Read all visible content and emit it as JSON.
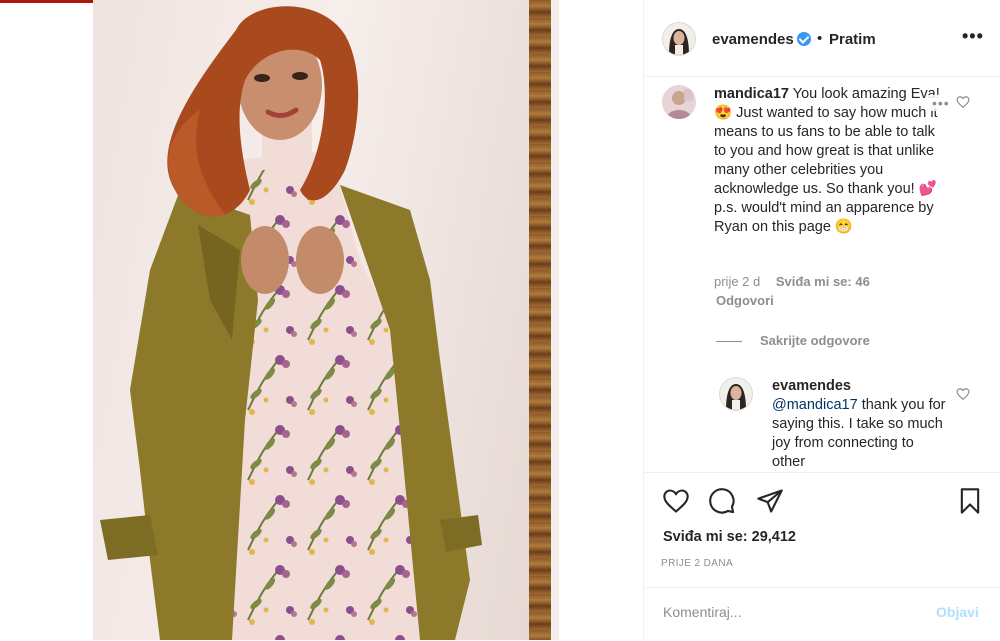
{
  "post": {
    "author": "evamendes",
    "follow_state": "Pratim",
    "more": "•••",
    "likes_text": "Sviđa mi se: 29,412",
    "time_text": "PRIJE 2 DANA"
  },
  "comment": {
    "username": "mandica17",
    "text": "You look amazing Eva! 😍 Just wanted to say how much it means to us fans to be able to talk to you and how great is that unlike many other celebrities you acknowledge us. So thank you! 💕 p.s. would't mind an apparence by Ryan on this page 😁",
    "more": "•••",
    "time": "prije 2 d",
    "likes": "Sviđa mi se: 46",
    "reply_label": "Odgovori",
    "hide_replies": "Sakrijte odgovore"
  },
  "reply": {
    "username": "evamendes",
    "mention": "@mandica17",
    "text": "thank you for saying this. I take so much joy from connecting to other"
  },
  "composer": {
    "placeholder": "Komentiraj...",
    "post_label": "Objavi"
  },
  "icons": {
    "like": "heart-icon",
    "comment": "comment-icon",
    "share": "share-icon",
    "save": "bookmark-icon",
    "verified": "verified-badge-icon",
    "more": "more-options-icon"
  },
  "colors": {
    "link_blue": "#003569",
    "verified_blue": "#3897f0",
    "post_disabled": "#b2dffc",
    "muted": "#8e8e8e",
    "coat": "#8c7a2a",
    "hair": "#a8491e"
  }
}
